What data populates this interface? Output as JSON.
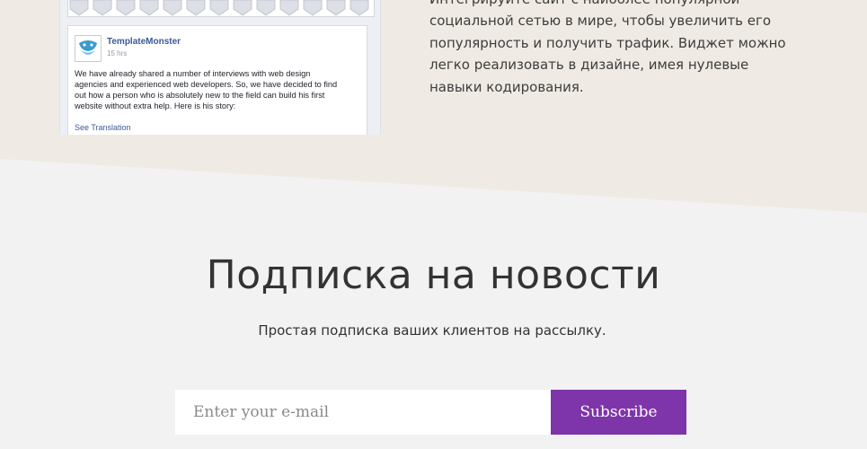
{
  "colors": {
    "top_background": "#efebe4",
    "page_background": "#f2f2f2",
    "facebook_blue": "#3b5998",
    "subscribe_button": "#7f35aa"
  },
  "facebook_widget": {
    "page_name": "TemplateMonster",
    "post_time": "15 hrs",
    "post_lines": [
      "We have already shared a number of interviews with web design",
      "agencies and experienced web developers. So, we have decided to find",
      "out how a person who is absolutely new to the field can build his first",
      "website without extra help. Here is his story:"
    ],
    "see_translation": "See Translation"
  },
  "description_lines": [
    "Интегрируйте сайт с наиболее популярной",
    "социальной сетью в мире, чтобы увеличить его",
    "популярность и получить трафик. Виджет можно",
    "легко реализовать в дизайне, имея нулевые",
    "навыки кодирования."
  ],
  "newsletter": {
    "title": "Подписка на новости",
    "subtitle": "Простая подписка ваших клиентов на рассылку.",
    "email_placeholder": "Enter your e-mail",
    "subscribe_label": "Subscribe"
  }
}
